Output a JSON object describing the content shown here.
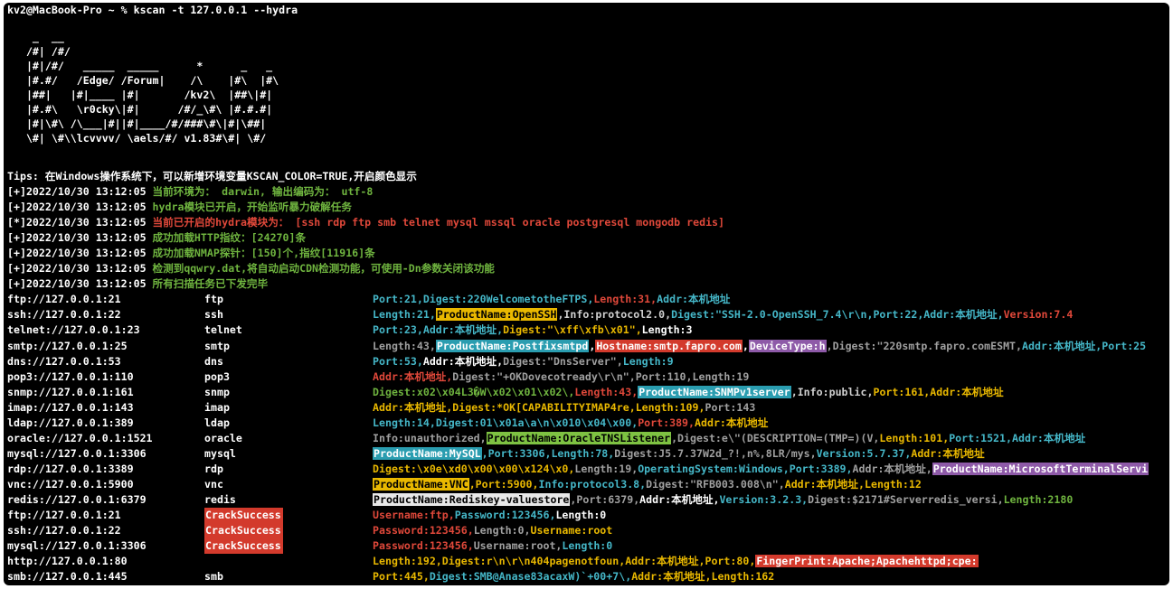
{
  "terminal": {
    "prompt": "kv2@MacBook-Pro ~ % kscan -t 127.0.0.1 --hydra",
    "banner": "    _  __\n   /#| /#/\n   |#|/#/   _____  _____      *      _   _\n   |#.#/   /Edge/ /Forum|    /\\    |#\\  |#\\\n   |##|   |#|____ |#|       /kv2\\  |##\\|#|\n   |#.#\\   \\r0cky\\|#|      /#/_\\#\\ |#.#.#|\n   |#|\\#\\ /\\___|#||#|____/#/###\\#\\|#|\\##|\n   \\#| \\#\\\\lcvvvv/ \\aels/#/ v1.83#\\#| \\#/",
    "tips": "Tips: 在Windows操作系统下，可以新增环境变量KSCAN_COLOR=TRUE,开启颜色显示",
    "log_lines": [
      {
        "prefix": "[+]2022/10/30 13:12:05 ",
        "text": "当前环境为： darwin, 输出编码为： utf-8",
        "color": "#6fb43f"
      },
      {
        "prefix": "[+]2022/10/30 13:12:05 ",
        "text": "hydra模块已开启，开始监听暴力破解任务",
        "color": "#6fb43f"
      },
      {
        "prefix": "[*]2022/10/30 13:12:05 ",
        "text": "当前已开启的hydra模块为： [ssh rdp ftp smb telnet mysql mssql oracle postgresql mongodb redis]",
        "color": "#e0483a"
      },
      {
        "prefix": "[+]2022/10/30 13:12:05 ",
        "text": "成功加载HTTP指纹：[24270]条",
        "color": "#6fb43f"
      },
      {
        "prefix": "[+]2022/10/30 13:12:05 ",
        "text": "成功加载NMAP探针：[150]个,指纹[11916]条",
        "color": "#6fb43f"
      },
      {
        "prefix": "[+]2022/10/30 13:12:05 ",
        "text": "检测到qqwry.dat,将自动启动CDN检测功能，可使用-Dn参数关闭该功能",
        "color": "#6fb43f"
      },
      {
        "prefix": "[+]2022/10/30 13:12:05 ",
        "text": "所有扫描任务已下发完毕",
        "color": "#6fb43f"
      }
    ],
    "results": [
      {
        "url": "ftp://127.0.0.1:21",
        "proto": "ftp",
        "segments": [
          {
            "t": "Port:21,",
            "c": "#45b7c8"
          },
          {
            "t": "Digest:220WelcometotheFTPS,",
            "c": "#45b7c8"
          },
          {
            "t": "Length:31,",
            "c": "#e0483a"
          },
          {
            "t": "Addr:本机地址",
            "c": "#45b7c8"
          }
        ]
      },
      {
        "url": "ssh://127.0.0.1:22",
        "proto": "ssh",
        "segments": [
          {
            "t": "Length:21,",
            "c": "#45b7c8"
          },
          {
            "t": "ProductName:OpenSSH",
            "c": "#000000",
            "bg": "#e9b800"
          },
          {
            "t": ",Info:protocol2.0,",
            "c": "#d0d0d0"
          },
          {
            "t": "Digest:\"SSH-2.0-OpenSSH_7.4\\r\\n,",
            "c": "#45b7c8"
          },
          {
            "t": "Port:22,",
            "c": "#45b7c8"
          },
          {
            "t": "Addr:本机地址,",
            "c": "#45b7c8"
          },
          {
            "t": "Version:7.4",
            "c": "#e0483a"
          }
        ]
      },
      {
        "url": "telnet://127.0.0.1:23",
        "proto": "telnet",
        "segments": [
          {
            "t": "Port:23,",
            "c": "#45b7c8"
          },
          {
            "t": "Addr:本机地址,",
            "c": "#45b7c8"
          },
          {
            "t": "Digest:\"\\xff\\xfb\\x01\",",
            "c": "#e9b800"
          },
          {
            "t": "Length:3",
            "c": "#ffffff"
          }
        ]
      },
      {
        "url": "smtp://127.0.0.1:25",
        "proto": "smtp",
        "segments": [
          {
            "t": "Length:43,",
            "c": "#a0a0a0"
          },
          {
            "t": "ProductName:Postfixsmtpd",
            "c": "#ffffff",
            "bg": "#2a9db0"
          },
          {
            "t": ",",
            "c": "#ffffff"
          },
          {
            "t": "Hostname:smtp.fapro.com",
            "c": "#ffffff",
            "bg": "#d33a2c"
          },
          {
            "t": ",",
            "c": "#ffffff"
          },
          {
            "t": "DeviceType:h",
            "c": "#ffffff",
            "bg": "#8e5aa8"
          },
          {
            "t": ",Digest:\"220smtp.fapro.comESMT,",
            "c": "#a0a0a0"
          },
          {
            "t": "Addr:本机地址,",
            "c": "#45b7c8"
          },
          {
            "t": "Port:25",
            "c": "#45b7c8"
          }
        ]
      },
      {
        "url": "dns://127.0.0.1:53",
        "proto": "dns",
        "segments": [
          {
            "t": "Port:53,",
            "c": "#45b7c8"
          },
          {
            "t": "Addr:本机地址,",
            "c": "#ffffff"
          },
          {
            "t": "Digest:\"DnsServer\",",
            "c": "#a0a0a0"
          },
          {
            "t": "Length:9",
            "c": "#45b7c8"
          }
        ]
      },
      {
        "url": "pop3://127.0.0.1:110",
        "proto": "pop3",
        "segments": [
          {
            "t": "Addr:本机地址,",
            "c": "#e0483a"
          },
          {
            "t": "Digest:\"+OKDovecotready\\r\\n\",",
            "c": "#a0a0a0"
          },
          {
            "t": "Port:110,",
            "c": "#a0a0a0"
          },
          {
            "t": "Length:19",
            "c": "#a0a0a0"
          }
        ]
      },
      {
        "url": "snmp://127.0.0.1:161",
        "proto": "snmp",
        "segments": [
          {
            "t": "Digest:x02\\x04L3�W\\x02\\x01\\x02\\,",
            "c": "#6fb43f"
          },
          {
            "t": "Length:43,",
            "c": "#e0483a"
          },
          {
            "t": "ProductName:SNMPv1server",
            "c": "#ffffff",
            "bg": "#2a9db0"
          },
          {
            "t": ",Info:public,",
            "c": "#d0d0d0"
          },
          {
            "t": "Port:161,",
            "c": "#e9b800"
          },
          {
            "t": "Addr:本机地址",
            "c": "#e9b800"
          }
        ]
      },
      {
        "url": "imap://127.0.0.1:143",
        "proto": "imap",
        "segments": [
          {
            "t": "Addr:本机地址,",
            "c": "#e9b800"
          },
          {
            "t": "Digest:*OK[CAPABILITYIMAP4re,",
            "c": "#e9b800"
          },
          {
            "t": "Length:109,",
            "c": "#e9b800"
          },
          {
            "t": "Port:143",
            "c": "#a0a0a0"
          }
        ]
      },
      {
        "url": "ldap://127.0.0.1:389",
        "proto": "ldap",
        "segments": [
          {
            "t": "Length:14,",
            "c": "#45b7c8"
          },
          {
            "t": "Digest:01\\x01a\\a\\n\\x010\\x04\\x00,",
            "c": "#45b7c8"
          },
          {
            "t": "Port:389,",
            "c": "#e0483a"
          },
          {
            "t": "Addr:本机地址",
            "c": "#e9b800"
          }
        ]
      },
      {
        "url": "oracle://127.0.0.1:1521",
        "proto": "oracle",
        "segments": [
          {
            "t": "Info:unauthorized,",
            "c": "#a0a0a0"
          },
          {
            "t": "ProductName:OracleTNSListener",
            "c": "#000000",
            "bg": "#7ec242"
          },
          {
            "t": ",Digest:e\\\"(DESCRIPTION=(TMP=)(V,",
            "c": "#a0a0a0"
          },
          {
            "t": "Length:101,",
            "c": "#e9b800"
          },
          {
            "t": "Port:1521,",
            "c": "#45b7c8"
          },
          {
            "t": "Addr:本机地址",
            "c": "#45b7c8"
          }
        ]
      },
      {
        "url": "mysql://127.0.0.1:3306",
        "proto": "mysql",
        "segments": [
          {
            "t": "ProductName:MySQL",
            "c": "#ffffff",
            "bg": "#2a9db0"
          },
          {
            "t": ",Port:3306,",
            "c": "#45b7c8"
          },
          {
            "t": "Length:78,",
            "c": "#45b7c8"
          },
          {
            "t": "Digest:J5.7.37W2d_?!,n%,8LR/mys,",
            "c": "#a0a0a0"
          },
          {
            "t": "Version:5.7.37,",
            "c": "#45b7c8"
          },
          {
            "t": "Addr:本机地址",
            "c": "#e9b800"
          }
        ]
      },
      {
        "url": "rdp://127.0.0.1:3389",
        "proto": "rdp",
        "segments": [
          {
            "t": "Digest:\\x0e\\xd0\\x00\\x00\\x124\\x0,",
            "c": "#e9b800"
          },
          {
            "t": "Length:19,",
            "c": "#a0a0a0"
          },
          {
            "t": "OperatingSystem:Windows,",
            "c": "#45b7c8"
          },
          {
            "t": "Port:3389,",
            "c": "#45b7c8"
          },
          {
            "t": "Addr:本机地址,",
            "c": "#a0a0a0"
          },
          {
            "t": "ProductName:MicrosoftTerminalServi",
            "c": "#ffffff",
            "bg": "#8e5aa8"
          }
        ]
      },
      {
        "url": "vnc://127.0.0.1:5900",
        "proto": "vnc",
        "segments": [
          {
            "t": "ProductName:VNC",
            "c": "#000000",
            "bg": "#e9b800"
          },
          {
            "t": ",Port:5900,",
            "c": "#e9b800"
          },
          {
            "t": "Info:protocol3.8,",
            "c": "#45b7c8"
          },
          {
            "t": "Digest:\"RFB003.008\\n\",",
            "c": "#a0a0a0"
          },
          {
            "t": "Addr:本机地址,",
            "c": "#e9b800"
          },
          {
            "t": "Length:12",
            "c": "#e9b800"
          }
        ]
      },
      {
        "url": "redis://127.0.0.1:6379",
        "proto": "redis",
        "segments": [
          {
            "t": "ProductName:Rediskey-valuestore",
            "c": "#000000",
            "bg": "#e8e8e8"
          },
          {
            "t": ",Port:6379,",
            "c": "#a0a0a0"
          },
          {
            "t": "Addr:本机地址,",
            "c": "#ffffff"
          },
          {
            "t": "Version:3.2.3,",
            "c": "#45b7c8"
          },
          {
            "t": "Digest:$2171#Serverredis_versi,",
            "c": "#a0a0a0"
          },
          {
            "t": "Length:2180",
            "c": "#6fb43f"
          }
        ]
      },
      {
        "url": "ftp://127.0.0.1:21",
        "proto": "CrackSuccess",
        "crack": true,
        "segments": [
          {
            "t": "Username:ftp,",
            "c": "#e0483a"
          },
          {
            "t": "Password:123456,",
            "c": "#45b7c8"
          },
          {
            "t": "Length:0",
            "c": "#ffffff"
          }
        ]
      },
      {
        "url": "ssh://127.0.0.1:22",
        "proto": "CrackSuccess",
        "crack": true,
        "segments": [
          {
            "t": "Password:123456,",
            "c": "#e0483a"
          },
          {
            "t": "Length:0,",
            "c": "#a0a0a0"
          },
          {
            "t": "Username:root",
            "c": "#e9b800"
          }
        ]
      },
      {
        "url": "mysql://127.0.0.1:3306",
        "proto": "CrackSuccess",
        "crack": true,
        "segments": [
          {
            "t": "Password:123456,",
            "c": "#e0483a"
          },
          {
            "t": "Username:root,",
            "c": "#a0a0a0"
          },
          {
            "t": "Length:0",
            "c": "#45b7c8"
          }
        ]
      },
      {
        "url": "http://127.0.0.1:80",
        "proto": "",
        "segments": [
          {
            "t": "Length:192,",
            "c": "#e9b800"
          },
          {
            "t": "Digest:r\\n\\r\\n404pagenotfoun,",
            "c": "#e9b800"
          },
          {
            "t": "Addr:本机地址,",
            "c": "#e9b800"
          },
          {
            "t": "Port:80,",
            "c": "#e9b800"
          },
          {
            "t": "FingerPrint:Apache;Apachehttpd;cpe:",
            "c": "#ffffff",
            "bg": "#d33a2c"
          }
        ]
      },
      {
        "url": "smb://127.0.0.1:445",
        "proto": "smb",
        "segments": [
          {
            "t": "Port:445,",
            "c": "#e9b800"
          },
          {
            "t": "Digest:SMB@Anase83acaxW)`+00+7\\,",
            "c": "#45b7c8"
          },
          {
            "t": "Addr:本机地址,",
            "c": "#e9b800"
          },
          {
            "t": "Length:162",
            "c": "#e9b800"
          }
        ]
      }
    ],
    "colors": {
      "background": "#000000",
      "text": "#ffffff",
      "green": "#6fb43f",
      "red": "#e0483a",
      "cyan": "#45b7c8",
      "yellow": "#e9b800",
      "crack_bg": "#d33a2c"
    }
  }
}
